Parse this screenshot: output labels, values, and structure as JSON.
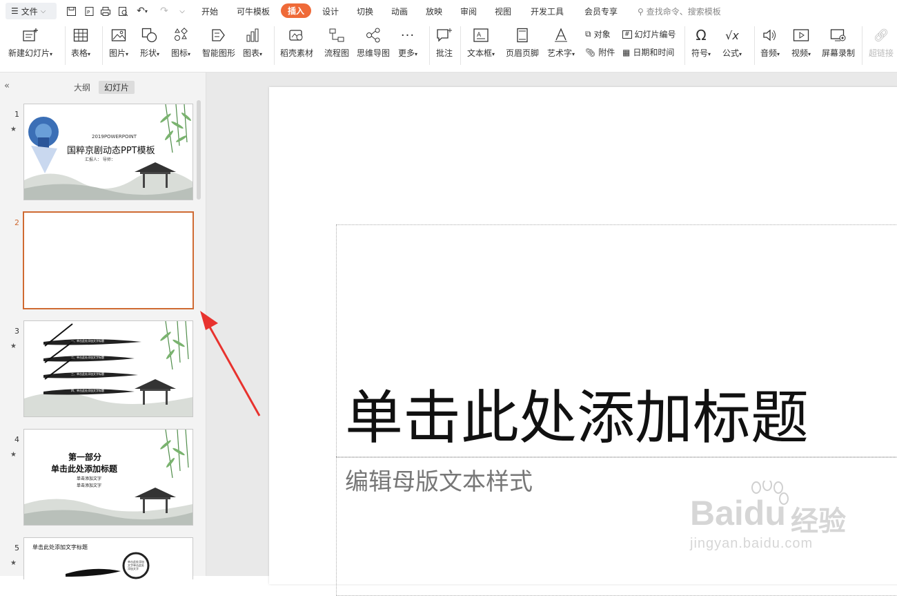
{
  "menubar": {
    "file_label": "文件",
    "tabs": [
      "开始",
      "可牛模板",
      "插入",
      "设计",
      "切换",
      "动画",
      "放映",
      "审阅",
      "视图",
      "开发工具",
      "会员专享"
    ],
    "active_tab": "插入",
    "search_placeholder": "查找命令、搜索模板"
  },
  "ribbon": {
    "new_slide": "新建幻灯片",
    "table": "表格",
    "picture": "图片",
    "shape": "形状",
    "icon": "图标",
    "smart_art": "智能图形",
    "chart": "图表",
    "material": "稻壳素材",
    "flowchart": "流程图",
    "mindmap": "思维导图",
    "more": "更多",
    "comment": "批注",
    "textbox": "文本框",
    "header_footer": "页眉页脚",
    "wordart": "艺术字",
    "object": "对象",
    "attachment": "附件",
    "slide_number": "幻灯片编号",
    "date_time": "日期和时间",
    "symbol": "符号",
    "formula": "公式",
    "audio": "音频",
    "video": "视频",
    "screen_record": "屏幕录制",
    "hyperlink": "超链接"
  },
  "panel": {
    "tab_outline": "大纲",
    "tab_slides": "幻灯片",
    "slides": [
      {
        "num": "1",
        "star": "★"
      },
      {
        "num": "2",
        "star": ""
      },
      {
        "num": "3",
        "star": "★"
      },
      {
        "num": "4",
        "star": "★"
      },
      {
        "num": "5",
        "star": "★"
      }
    ],
    "slide1": {
      "year": "2019POWERPOINT",
      "title": "国粹京剧动态PPT模板",
      "reporter": "汇报人：   导师："
    },
    "slide3": {
      "items": [
        "一、单击此处添加文字标题",
        "二、单击此处添加文字标题",
        "三、单击此处添加文字标题",
        "四、单击此处添加文字标题"
      ]
    },
    "slide4": {
      "part": "第一部分",
      "title": "单击此处添加标题",
      "bullets": [
        "单击添加文字",
        "单击添加文字"
      ]
    },
    "slide5": {
      "title": "单击此处添加文字标题",
      "text": "单击此处添加文字单击此处添加文字"
    }
  },
  "slide": {
    "title": "单击此处添加标题",
    "subtitle": "编辑母版文本样式"
  },
  "watermark": {
    "brand": "Baidu",
    "brand_cn": "经验",
    "url": "jingyan.baidu.com"
  },
  "colors": {
    "accent": "#ef6a38",
    "selected_border": "#cf6a32",
    "arrow": "#e8322e"
  }
}
